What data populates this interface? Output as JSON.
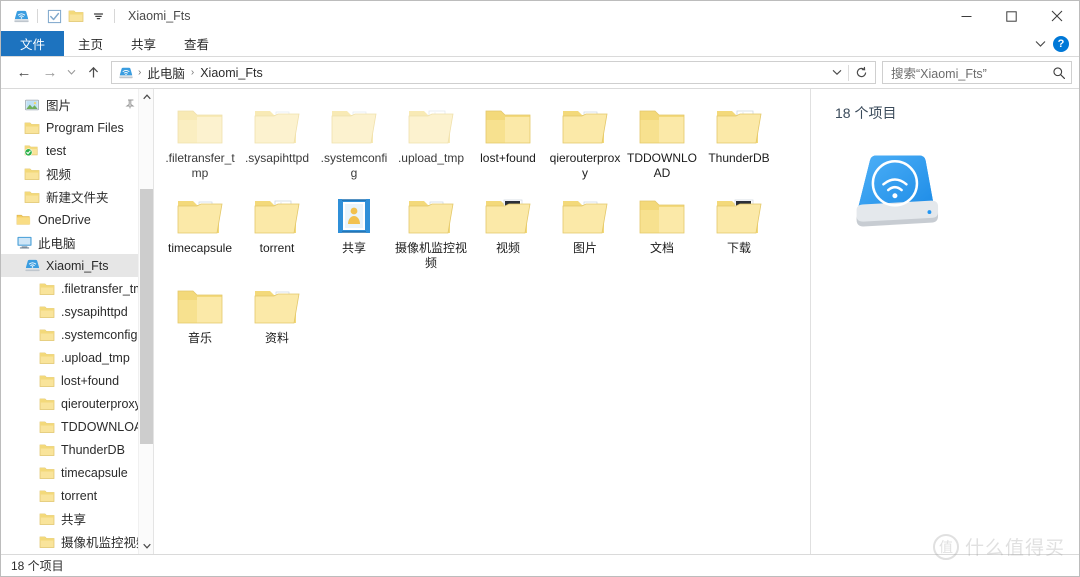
{
  "window": {
    "title": "Xiaomi_Fts",
    "quick_access": [
      {
        "name": "drive-icon",
        "label": "Xiaomi_Fts"
      },
      {
        "name": "properties-icon",
        "label": "属性"
      },
      {
        "name": "new-folder-icon",
        "label": "新建文件夹"
      },
      {
        "name": "customize-dropdown-icon",
        "label": "自定义快速访问工具栏"
      }
    ],
    "controls": {
      "minimize": "—",
      "maximize": "□",
      "close": "✕"
    }
  },
  "ribbon": {
    "tabs": [
      {
        "label": "文件",
        "active": true
      },
      {
        "label": "主页",
        "active": false
      },
      {
        "label": "共享",
        "active": false
      },
      {
        "label": "查看",
        "active": false
      }
    ],
    "collapse_label": "∨",
    "help_label": "?"
  },
  "navigation": {
    "back": "←",
    "forward": "→",
    "recent": "∨",
    "up": "↑",
    "breadcrumb": [
      "此电脑",
      "Xiaomi_Fts"
    ],
    "breadcrumb_sep": "›",
    "dropdown": "∨",
    "refresh": "↻"
  },
  "search": {
    "placeholder": "搜索“Xiaomi_Fts”",
    "icon": "search-icon"
  },
  "sidebar": {
    "items": [
      {
        "label": "图片",
        "icon": "pictures-icon",
        "level": 1,
        "pinned": true,
        "selected": false
      },
      {
        "label": "Program Files",
        "icon": "folder-icon",
        "level": 1,
        "selected": false
      },
      {
        "label": "test",
        "icon": "folder-sync-icon",
        "level": 1,
        "selected": false
      },
      {
        "label": "视频",
        "icon": "folder-icon",
        "level": 1,
        "selected": false
      },
      {
        "label": "新建文件夹",
        "icon": "folder-icon",
        "level": 1,
        "selected": false
      },
      {
        "label": "OneDrive",
        "icon": "onedrive-icon",
        "level": 0,
        "selected": false
      },
      {
        "label": "此电脑",
        "icon": "this-pc-icon",
        "level": 0,
        "selected": false
      },
      {
        "label": "Xiaomi_Fts",
        "icon": "drive-icon",
        "level": 1,
        "selected": true
      },
      {
        "label": ".filetransfer_tmp",
        "icon": "folder-icon",
        "level": 2,
        "selected": false
      },
      {
        "label": ".sysapihttpd",
        "icon": "folder-icon",
        "level": 2,
        "selected": false
      },
      {
        "label": ".systemconfig",
        "icon": "folder-icon",
        "level": 2,
        "selected": false
      },
      {
        "label": ".upload_tmp",
        "icon": "folder-icon",
        "level": 2,
        "selected": false
      },
      {
        "label": "lost+found",
        "icon": "folder-icon",
        "level": 2,
        "selected": false
      },
      {
        "label": "qierouterproxy",
        "icon": "folder-icon",
        "level": 2,
        "selected": false
      },
      {
        "label": "TDDOWNLOAD",
        "icon": "folder-icon",
        "level": 2,
        "selected": false
      },
      {
        "label": "ThunderDB",
        "icon": "folder-icon",
        "level": 2,
        "selected": false
      },
      {
        "label": "timecapsule",
        "icon": "folder-icon",
        "level": 2,
        "selected": false
      },
      {
        "label": "torrent",
        "icon": "folder-icon",
        "level": 2,
        "selected": false
      },
      {
        "label": "共享",
        "icon": "folder-icon",
        "level": 2,
        "selected": false
      },
      {
        "label": "摄像机监控视频",
        "icon": "folder-icon",
        "level": 2,
        "selected": false
      }
    ],
    "scroll_up": "⌃",
    "scroll_down": "⌄"
  },
  "files": [
    {
      "label": ".filetransfer_tmp",
      "type": "folder-plain",
      "hidden": true
    },
    {
      "label": ".sysapihttpd",
      "type": "folder-docs",
      "hidden": true
    },
    {
      "label": ".systemconfig",
      "type": "folder-docs",
      "hidden": true
    },
    {
      "label": ".upload_tmp",
      "type": "folder-paper",
      "hidden": true
    },
    {
      "label": "lost+found",
      "type": "folder-plain",
      "hidden": false
    },
    {
      "label": "qierouterproxy",
      "type": "folder-docs",
      "hidden": false
    },
    {
      "label": "TDDOWNLOAD",
      "type": "folder-plain",
      "hidden": false
    },
    {
      "label": "ThunderDB",
      "type": "folder-paper",
      "hidden": false
    },
    {
      "label": "timecapsule",
      "type": "folder-docs",
      "hidden": false
    },
    {
      "label": "torrent",
      "type": "folder-paper",
      "hidden": false
    },
    {
      "label": "共享",
      "type": "folder-shared",
      "hidden": false
    },
    {
      "label": "摄像机监控视频",
      "type": "folder-docs",
      "hidden": false
    },
    {
      "label": "视频",
      "type": "folder-photo",
      "hidden": false
    },
    {
      "label": "图片",
      "type": "folder-docs",
      "hidden": false
    },
    {
      "label": "文档",
      "type": "folder-plain",
      "hidden": false
    },
    {
      "label": "下载",
      "type": "folder-photo",
      "hidden": false
    },
    {
      "label": "音乐",
      "type": "folder-plain",
      "hidden": false
    },
    {
      "label": "资料",
      "type": "folder-docs",
      "hidden": false
    }
  ],
  "details": {
    "count_label": "18 个项目",
    "icon": "wireless-drive-icon"
  },
  "status": {
    "count_label": "18 个项目"
  },
  "watermark": {
    "logo": "值",
    "text": "什么值得买"
  },
  "colors": {
    "accent": "#1d73bf",
    "folder": "#ffd866",
    "drive_blue": "#3aa0f3",
    "selection": "#e6e6e6"
  }
}
